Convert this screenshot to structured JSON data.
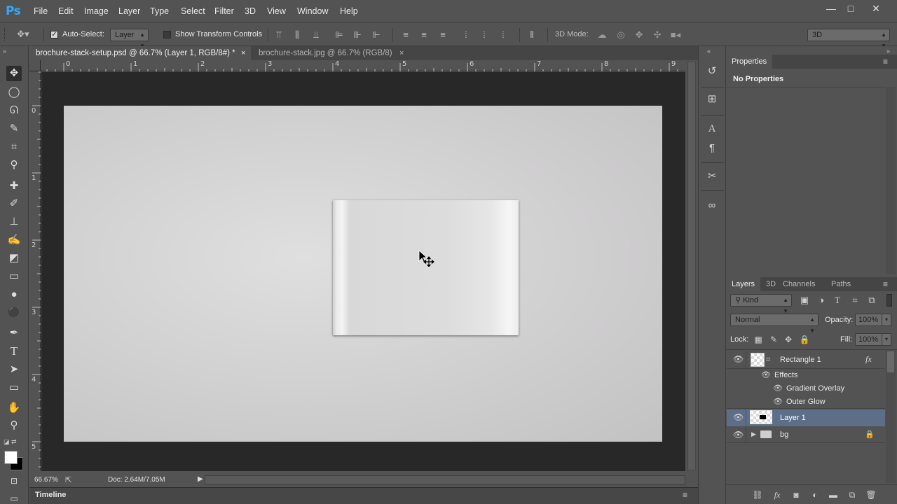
{
  "app": {
    "logo": "Ps",
    "menu": [
      "File",
      "Edit",
      "Image",
      "Layer",
      "Type",
      "Select",
      "Filter",
      "3D",
      "View",
      "Window",
      "Help"
    ],
    "window_controls": [
      "—",
      "□",
      "✕"
    ]
  },
  "options_bar": {
    "auto_select_label": "Auto-Select:",
    "auto_select_checked": true,
    "auto_select_target": "Layer",
    "show_transform_label": "Show Transform Controls",
    "show_transform_checked": false,
    "mode_3d_label": "3D Mode:",
    "workspace": "3D"
  },
  "tabs": [
    {
      "label": "brochure-stack-setup.psd @ 66.7% (Layer 1, RGB/8#) *",
      "active": true
    },
    {
      "label": "brochure-stack.jpg @ 66.7% (RGB/8)",
      "active": false
    }
  ],
  "ruler": {
    "top_numbers": [
      "0",
      "1",
      "2",
      "3",
      "4",
      "5",
      "6",
      "7",
      "8",
      "9"
    ],
    "left_numbers": [
      "0",
      "1",
      "2",
      "3",
      "4",
      "5"
    ]
  },
  "status": {
    "zoom": "66.67%",
    "doc_size": "Doc: 2.64M/7.05M"
  },
  "timeline_label": "Timeline",
  "properties": {
    "title": "Properties",
    "content": "No Properties"
  },
  "layers_panel": {
    "tabs": [
      "Layers",
      "3D",
      "Channels",
      "Paths"
    ],
    "filter_kind": "Kind",
    "blend_mode": "Normal",
    "opacity_label": "Opacity:",
    "opacity": "100%",
    "lock_label": "Lock:",
    "fill_label": "Fill:",
    "fill": "100%",
    "layers": [
      {
        "name": "Rectangle 1",
        "fx": "fx"
      },
      {
        "name": "Effects"
      },
      {
        "name": "Gradient Overlay"
      },
      {
        "name": "Outer Glow"
      },
      {
        "name": "Layer 1",
        "selected": true
      },
      {
        "name": "bg",
        "group": true,
        "locked": true
      }
    ]
  },
  "colors": {
    "chrome": "#535353",
    "pasteboard": "#282828",
    "selected_layer": "#5d6e89",
    "ps_blue": "#31a8ff"
  }
}
